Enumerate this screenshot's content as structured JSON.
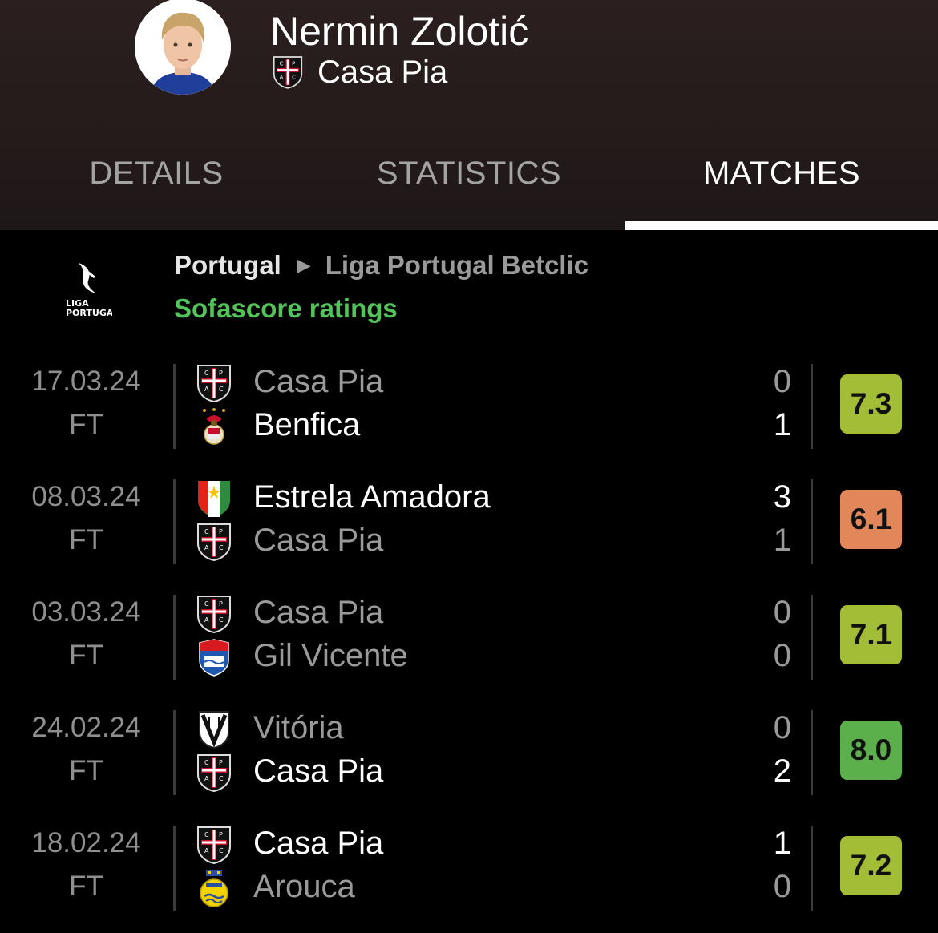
{
  "player": {
    "name": "Nermin Zolotić",
    "team": "Casa Pia"
  },
  "tabs": [
    {
      "label": "DETAILS",
      "active": false
    },
    {
      "label": "STATISTICS",
      "active": false
    },
    {
      "label": "MATCHES",
      "active": true
    }
  ],
  "league": {
    "logo_text_1": "LIGA",
    "logo_text_2": "PORTUGAL",
    "country": "Portugal",
    "name": "Liga Portugal Betclic",
    "ratings_label": "Sofascore ratings"
  },
  "matches": [
    {
      "date": "17.03.24",
      "status": "FT",
      "home": {
        "name": "Casa Pia",
        "score": "0",
        "crest": "casa-pia-crest",
        "winner": false
      },
      "away": {
        "name": "Benfica",
        "score": "1",
        "crest": "benfica-crest",
        "winner": true
      },
      "rating": "7.3",
      "rating_color": "#a4bd37"
    },
    {
      "date": "08.03.24",
      "status": "FT",
      "home": {
        "name": "Estrela Amadora",
        "score": "3",
        "crest": "estrela-amadora-crest",
        "winner": true
      },
      "away": {
        "name": "Casa Pia",
        "score": "1",
        "crest": "casa-pia-crest",
        "winner": false
      },
      "rating": "6.1",
      "rating_color": "#e2875a"
    },
    {
      "date": "03.03.24",
      "status": "FT",
      "home": {
        "name": "Casa Pia",
        "score": "0",
        "crest": "casa-pia-crest",
        "winner": false
      },
      "away": {
        "name": "Gil Vicente",
        "score": "0",
        "crest": "gil-vicente-crest",
        "winner": false
      },
      "rating": "7.1",
      "rating_color": "#a4bd37"
    },
    {
      "date": "24.02.24",
      "status": "FT",
      "home": {
        "name": "Vitória",
        "score": "0",
        "crest": "vitoria-crest",
        "winner": false
      },
      "away": {
        "name": "Casa Pia",
        "score": "2",
        "crest": "casa-pia-crest",
        "winner": true
      },
      "rating": "8.0",
      "rating_color": "#5cb04c"
    },
    {
      "date": "18.02.24",
      "status": "FT",
      "home": {
        "name": "Casa Pia",
        "score": "1",
        "crest": "casa-pia-crest",
        "winner": true
      },
      "away": {
        "name": "Arouca",
        "score": "0",
        "crest": "arouca-crest",
        "winner": false
      },
      "rating": "7.2",
      "rating_color": "#a4bd37"
    }
  ]
}
